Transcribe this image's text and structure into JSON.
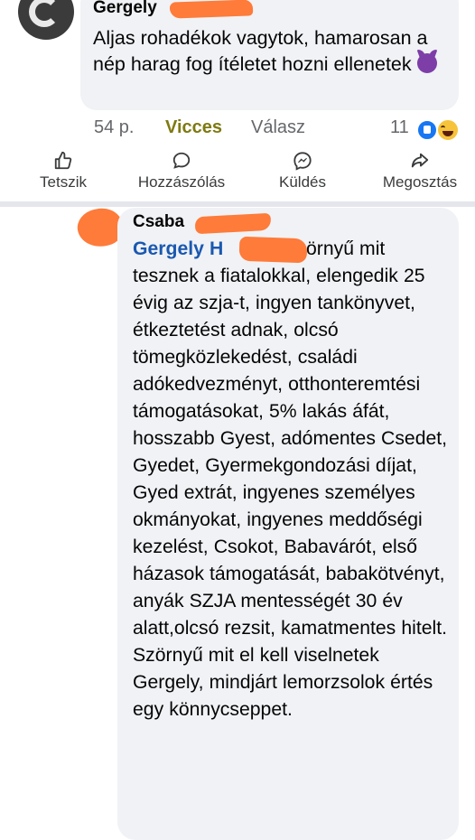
{
  "comment": {
    "author": "Gergely",
    "text": "Aljas rohadékok vagytok, hamarosan a nép harag fog ítéletet hozni ellenetek",
    "emoji": "devil-emoji",
    "time": "54 p.",
    "reaction_label": "Vicces",
    "reply_label": "Válasz",
    "reaction_count": "11",
    "reaction_icons": [
      "like-reaction-icon",
      "haha-reaction-icon"
    ]
  },
  "actions": {
    "like": "Tetszik",
    "comment": "Hozzászólás",
    "send": "Küldés",
    "share": "Megosztás"
  },
  "reply": {
    "author": "Csaba",
    "mention": "Gergely H",
    "text": "Szörnyű mit tesznek a fiatalokkal, elengedik 25 évig az szja-t, ingyen tankönyvet, étkeztetést adnak, olcsó tömegközlekedést, családi adókedvezményt, otthonteremtési támogatásokat, 5% lakás áfát, hosszabb Gyest, adómentes Csedet, Gyedet, Gyermekgondozási díjat, Gyed extrát, ingyenes személyes okmányokat, ingyenes meddőségi kezelést, Csokot, Babavárót, első házasok támogatását, babakötvényt, anyák SZJA mentességét 30 év alatt,olcsó rezsit, kamatmentes hitelt. Szörnyű mit el kell viselnetek Gergely, mindjárt lemorzsolok értés egy könnycseppet."
  },
  "colors": {
    "bubble": "#f0f2f5",
    "redaction": "#fe7b3a",
    "mention": "#1a58b0",
    "funny_label": "#7e7a10",
    "meta": "#65676b",
    "divider": "#e4e6eb"
  }
}
